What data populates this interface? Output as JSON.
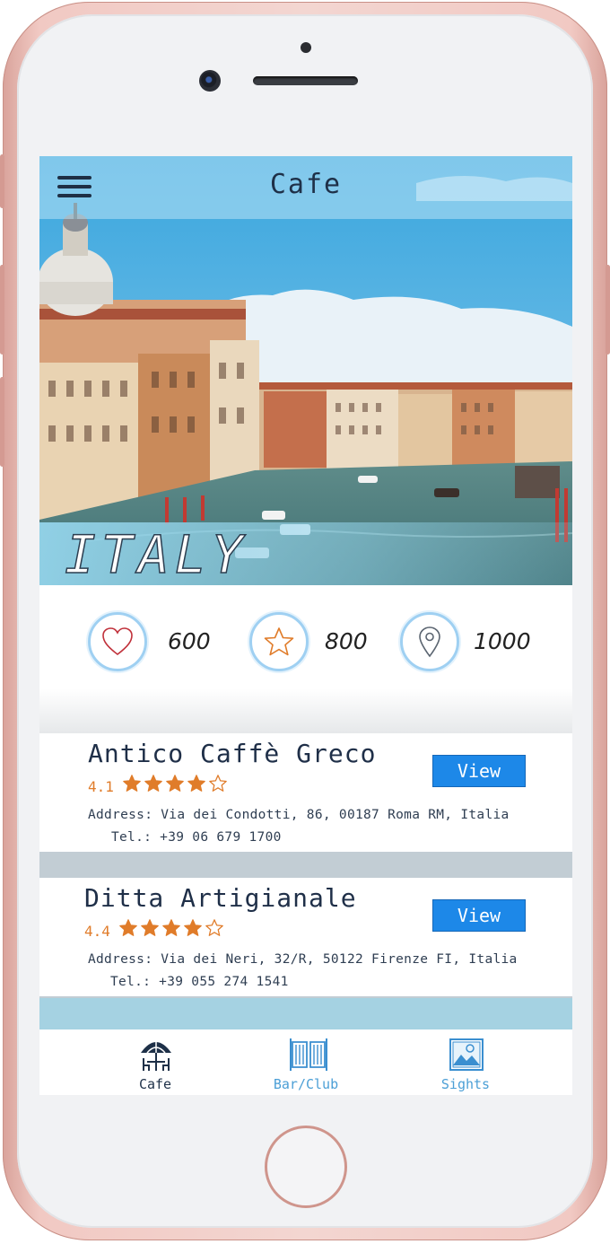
{
  "header": {
    "title": "Cafe"
  },
  "hero": {
    "country": "ITALY"
  },
  "stats": [
    {
      "icon": "heart-icon",
      "value": "600"
    },
    {
      "icon": "star-icon",
      "value": "800"
    },
    {
      "icon": "location-pin-icon",
      "value": "1000"
    }
  ],
  "cafes": [
    {
      "name": "Antico Caffè Greco",
      "rating": "4.1",
      "stars_filled": 4,
      "stars_total": 5,
      "address": "Address: Via dei Condotti, 86, 00187 Roma RM, Italia",
      "phone": "Tel.: +39 06 679 1700",
      "action_label": "View"
    },
    {
      "name": "Ditta Artigianale",
      "rating": "4.4",
      "stars_filled": 4,
      "stars_total": 5,
      "address": "Address: Via dei Neri, 32/R, 50122 Firenze FI, Italia",
      "phone": "Tel.: +39 055 274 1541",
      "action_label": "View"
    }
  ],
  "tabs": [
    {
      "label": "Cafe",
      "icon": "umbrella-table-icon",
      "active": true
    },
    {
      "label": "Bar/Club",
      "icon": "saloon-doors-icon",
      "active": false
    },
    {
      "label": "Sights",
      "icon": "landscape-picture-icon",
      "active": false
    }
  ],
  "colors": {
    "accent": "#1d88e8",
    "rating": "#e07c2a",
    "tab_active": "#1e3048",
    "tab_inactive": "#4b9fd6",
    "stat_border": "#9fd0f2"
  }
}
